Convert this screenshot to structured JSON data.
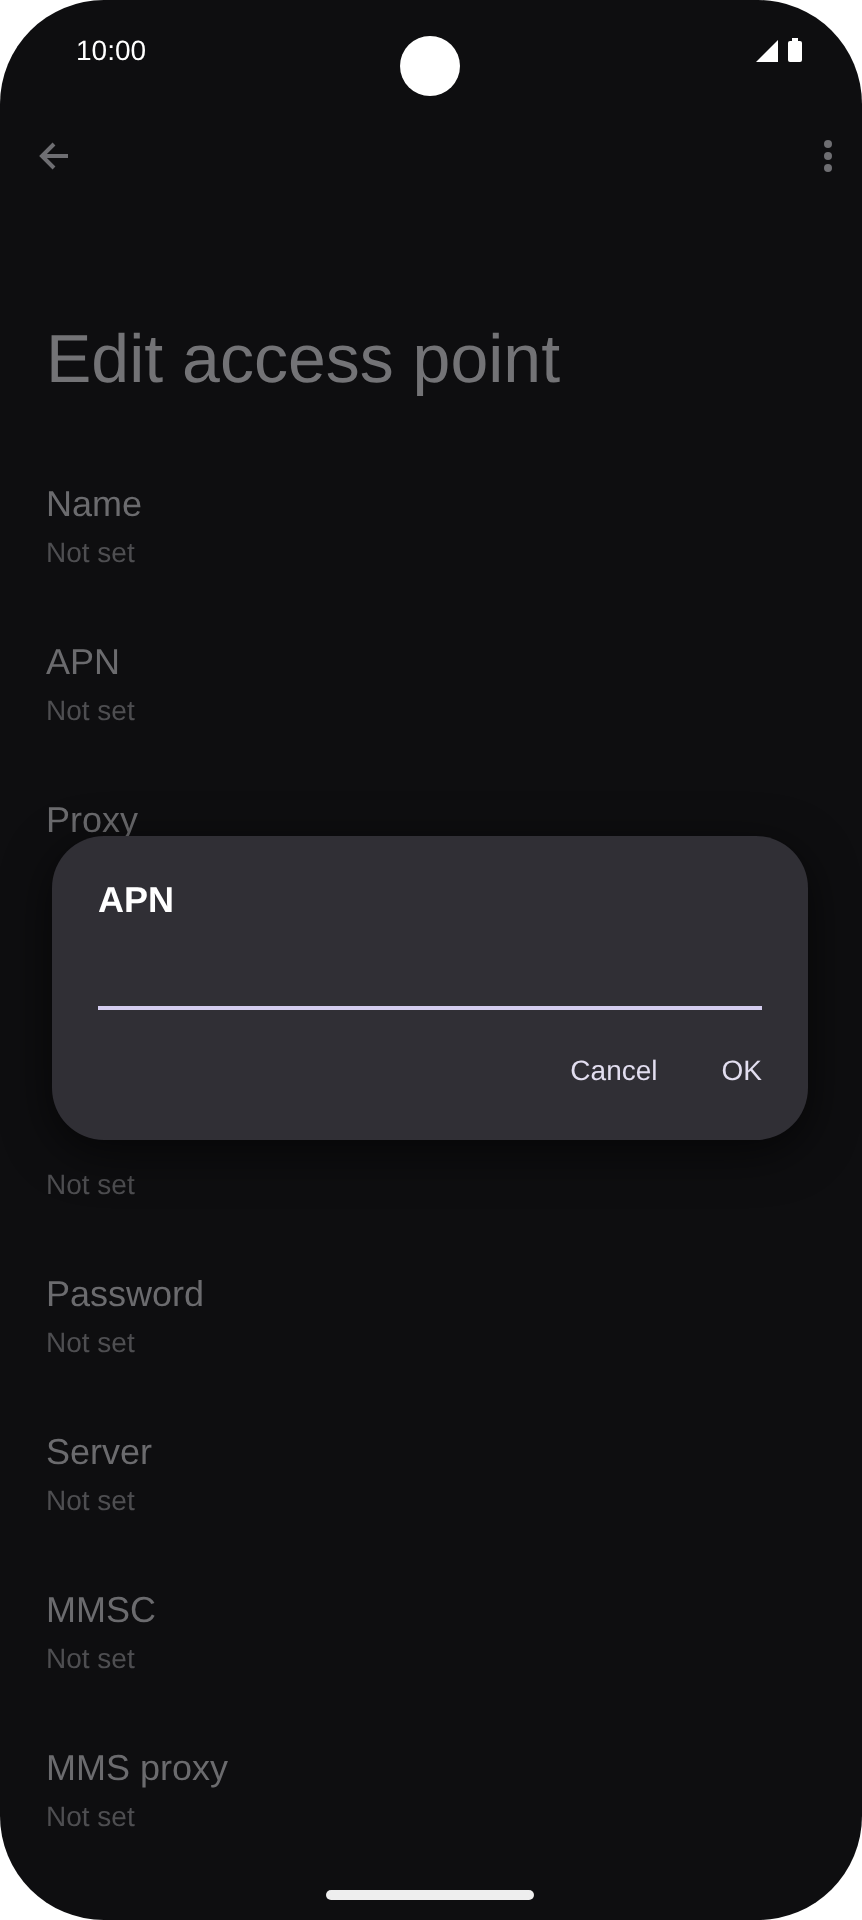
{
  "status_bar": {
    "time": "10:00"
  },
  "toolbar": {
    "title": "Edit access point"
  },
  "settings": [
    {
      "kind": "setting",
      "label": "Name",
      "value": "Not set"
    },
    {
      "kind": "setting",
      "label": "APN",
      "value": "Not set"
    },
    {
      "kind": "setting",
      "label": "Proxy"
    },
    {
      "kind": "covered"
    },
    {
      "kind": "setting",
      "value": "Not set"
    },
    {
      "kind": "setting",
      "label": "Password",
      "value": "Not set"
    },
    {
      "kind": "setting",
      "label": "Server",
      "value": "Not set"
    },
    {
      "kind": "setting",
      "label": "MMSC",
      "value": "Not set"
    },
    {
      "kind": "setting",
      "label": "MMS proxy",
      "value": "Not set"
    }
  ],
  "dialog": {
    "title": "APN",
    "buttons": [
      "Cancel",
      "OK"
    ]
  }
}
